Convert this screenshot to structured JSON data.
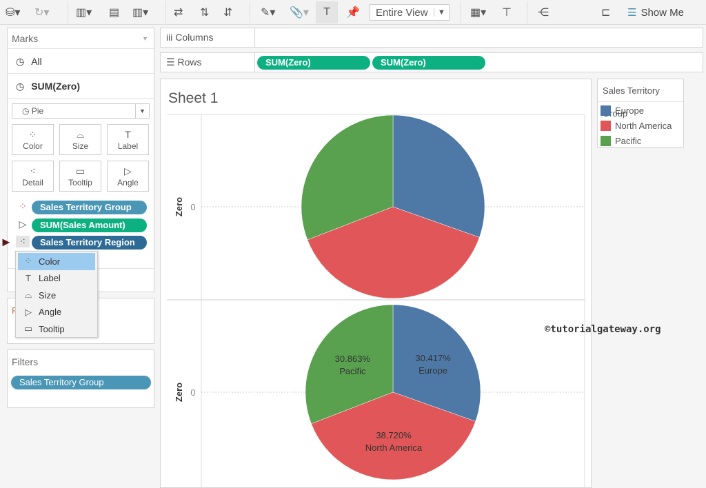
{
  "toolbar": {
    "view_select": "Entire View",
    "show_me": "Show Me"
  },
  "marks": {
    "title": "Marks",
    "all": "All",
    "measure": "SUM(Zero)",
    "mark_type": "Pie",
    "cards": [
      {
        "label": "Color",
        "icon": "color-icon"
      },
      {
        "label": "Size",
        "icon": "size-icon"
      },
      {
        "label": "Label",
        "icon": "label-icon"
      },
      {
        "label": "Detail",
        "icon": "detail-icon"
      },
      {
        "label": "Tooltip",
        "icon": "tooltip-icon"
      },
      {
        "label": "Angle",
        "icon": "angle-icon"
      }
    ],
    "pills": [
      {
        "label": "Sales Territory Group",
        "role": "color"
      },
      {
        "label": "SUM(Sales Amount)",
        "role": "angle"
      },
      {
        "label": "Sales Territory Region",
        "role": "detail"
      }
    ]
  },
  "context_menu": {
    "items": [
      "Color",
      "Label",
      "Size",
      "Angle",
      "Tooltip"
    ],
    "selected": "Color"
  },
  "pages_partial": "F",
  "filters": {
    "title": "Filters",
    "items": [
      "Sales Territory Group"
    ]
  },
  "shelves": {
    "columns_label": "Columns",
    "rows_label": "Rows",
    "rows_pills": [
      "SUM(Zero)",
      "SUM(Zero)"
    ]
  },
  "sheet": {
    "title": "Sheet 1",
    "axis_label": "Zero",
    "tick": "0"
  },
  "legend": {
    "title": "Sales Territory Group",
    "items": [
      {
        "name": "Europe",
        "color": "#4e79a7"
      },
      {
        "name": "North America",
        "color": "#e15759"
      },
      {
        "name": "Pacific",
        "color": "#59a14f"
      }
    ]
  },
  "watermark": "©tutorialgateway.org",
  "chart_data": [
    {
      "type": "pie",
      "categories": [
        "Europe",
        "North America",
        "Pacific"
      ],
      "values": [
        30.417,
        38.72,
        30.863
      ],
      "labels_shown": false
    },
    {
      "type": "pie",
      "categories": [
        "Europe",
        "North America",
        "Pacific"
      ],
      "values": [
        30.417,
        38.72,
        30.863
      ],
      "labels_shown": true,
      "data_labels": [
        {
          "value": "30.417%",
          "name": "Europe"
        },
        {
          "value": "38.720%",
          "name": "North America"
        },
        {
          "value": "30.863%",
          "name": "Pacific"
        }
      ]
    }
  ]
}
